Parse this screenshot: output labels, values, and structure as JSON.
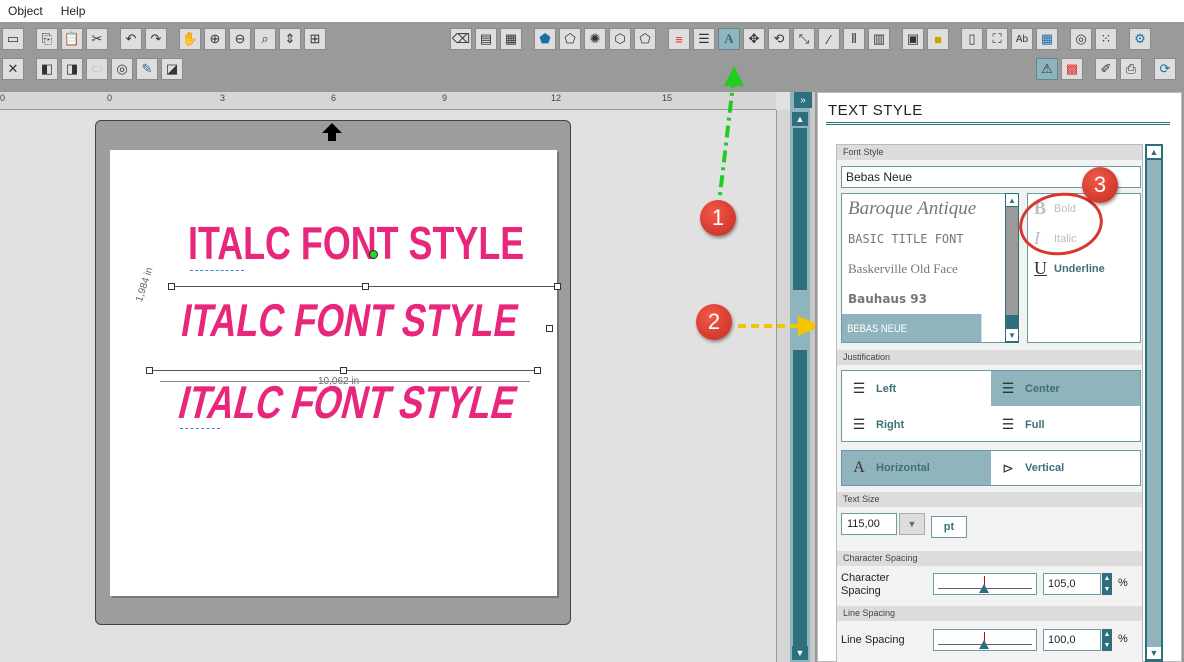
{
  "menu": {
    "object": "Object",
    "help": "Help"
  },
  "ruler": {
    "labels": [
      "0",
      "0",
      "3",
      "6",
      "9",
      "12",
      "15"
    ]
  },
  "canvas": {
    "sample_regular": "ITALC FONT STYLE",
    "sample_italic": "ITALC FONT STYLE",
    "sample_italic2": "ITALC FONT STYLE",
    "dim_height": "1,984 in",
    "dim_width": "10,062 in"
  },
  "callouts": {
    "one": "1",
    "two": "2",
    "three": "3"
  },
  "colors": {
    "accent": "#2e6f7d",
    "selected": "#8fb4bc",
    "sample": "#e8277c",
    "callout": "#d8382c",
    "arrow_green": "#22cc22",
    "arrow_yellow": "#f5c400"
  },
  "panel": {
    "title": "TEXT STYLE",
    "font_style_header": "Font Style",
    "font_name": "Bebas Neue",
    "fonts": [
      "Baroque Antique",
      "BASIC TITLE FONT",
      "Baskerville Old Face",
      "Bauhaus 93",
      "BEBAS NEUE"
    ],
    "bold": "Bold",
    "italic": "Italic",
    "underline": "Underline",
    "justification_header": "Justification",
    "left": "Left",
    "center": "Center",
    "right": "Right",
    "full": "Full",
    "horizontal": "Horizontal",
    "vertical": "Vertical",
    "text_size_header": "Text Size",
    "text_size": "115,00",
    "unit": "pt",
    "char_spacing_header": "Character Spacing",
    "char_spacing_label": "Character Spacing",
    "char_spacing_value": "105,0",
    "line_spacing_header": "Line Spacing",
    "line_spacing_label": "Line Spacing",
    "line_spacing_value": "100,0",
    "percent": "%"
  }
}
